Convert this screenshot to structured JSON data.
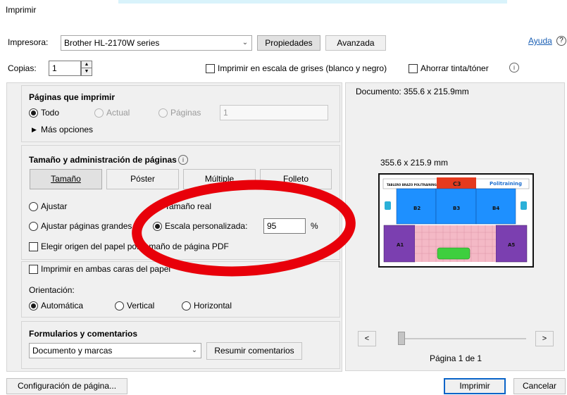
{
  "window": {
    "title": "Imprimir"
  },
  "printer": {
    "label": "Impresora:",
    "selected": "Brother HL-2170W series",
    "properties_label": "Propiedades",
    "advanced_label": "Avanzada",
    "help_label": "Ayuda",
    "help_icon": "?"
  },
  "copies": {
    "label": "Copias:",
    "value": "1"
  },
  "options": {
    "grayscale_label": "Imprimir en escala de grises (blanco y negro)",
    "save_ink_label": "Ahorrar tinta/tóner",
    "info_icon": "i"
  },
  "pages_to_print": {
    "title": "Páginas que imprimir",
    "all_label": "Todo",
    "current_label": "Actual",
    "pages_label": "Páginas",
    "pages_value": "1",
    "more_options_label": "Más opciones"
  },
  "page_handling": {
    "title": "Tamaño y administración de páginas",
    "info_icon": "i",
    "tabs": [
      {
        "label": "Tamaño"
      },
      {
        "label": "Póster"
      },
      {
        "label": "Múltiple"
      },
      {
        "label": "Folleto"
      }
    ],
    "fit_label": "Ajustar",
    "actual_size_label": "Tamaño real",
    "shrink_label": "Ajustar páginas grandes",
    "custom_scale_label": "Escala personalizada:",
    "scale_value": "95",
    "scale_unit": "%",
    "choose_source_label": "Elegir origen del papel por tamaño de página PDF"
  },
  "duplex": {
    "label": "Imprimir en ambas caras del papel"
  },
  "orientation": {
    "label": "Orientación:",
    "auto_label": "Automática",
    "portrait_label": "Vertical",
    "landscape_label": "Horizontal"
  },
  "comments": {
    "title": "Formularios y comentarios",
    "selected": "Documento y marcas",
    "summarize_label": "Resumir comentarios"
  },
  "preview": {
    "document_size": "Documento: 355.6 x 215.9mm",
    "paper_size": "355.6 x 215.9 mm",
    "page_indicator": "Página 1 de 1",
    "prev_label": "<",
    "next_label": ">",
    "slider_position": 0.0,
    "thumbnail": {
      "header_text": "TABLERO BRAZO POLITRAINING",
      "brand": "Politraining",
      "cells": [
        "C3",
        "B2",
        "B3",
        "B4",
        "A1",
        "A5"
      ]
    }
  },
  "footer": {
    "page_setup_label": "Configuración de página...",
    "print_label": "Imprimir",
    "cancel_label": "Cancelar"
  },
  "colors": {
    "annotation_ring": "#e8000a",
    "accent_link": "#1a5fb4",
    "thumb_blue": "#1e90ff",
    "thumb_purple": "#7b3fb0",
    "thumb_red": "#e53a1e",
    "thumb_green": "#3ecf3e",
    "thumb_pink": "#f4b9c6"
  }
}
